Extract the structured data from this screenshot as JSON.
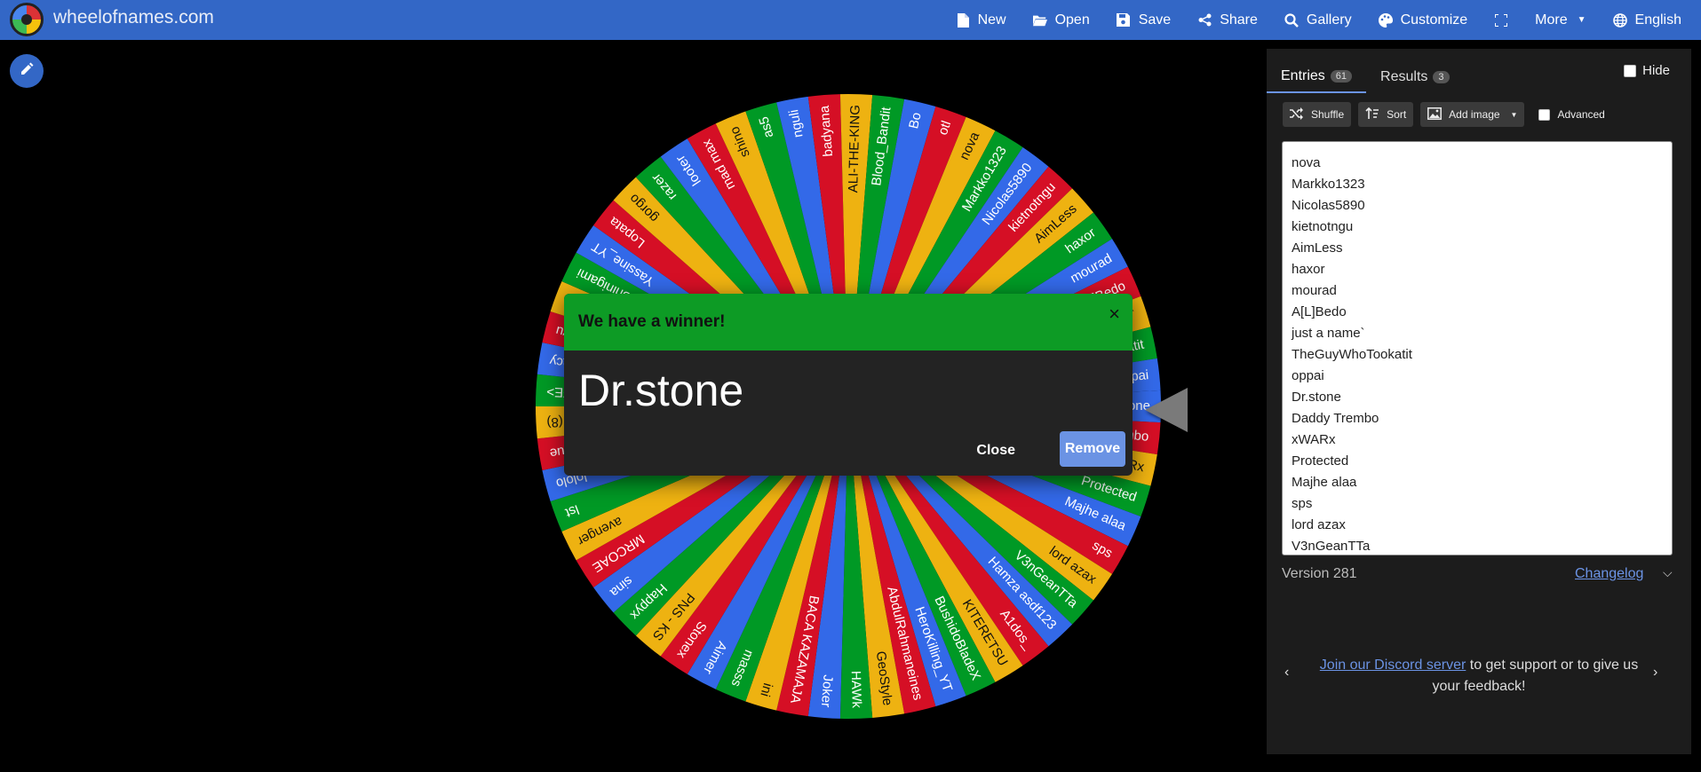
{
  "header": {
    "site_title": "wheelofnames.com",
    "nav": [
      {
        "label": "New",
        "icon": "file-icon"
      },
      {
        "label": "Open",
        "icon": "folder-icon"
      },
      {
        "label": "Save",
        "icon": "save-icon"
      },
      {
        "label": "Share",
        "icon": "share-icon"
      },
      {
        "label": "Gallery",
        "icon": "search-icon"
      },
      {
        "label": "Customize",
        "icon": "palette-icon"
      },
      {
        "label": "",
        "icon": "fullscreen-icon"
      },
      {
        "label": "More",
        "icon": "chevron-down-icon"
      },
      {
        "label": "English",
        "icon": "globe-icon"
      }
    ]
  },
  "wheel": {
    "colors": [
      "#3369e8",
      "#d50f25",
      "#eeb211",
      "#009925"
    ],
    "segment_count": 61,
    "visible_labels": [
      "nova",
      "Markko1323",
      "Nicolas5890",
      "kietnotngu",
      "AimLess",
      "haxor",
      "mourad",
      "A[L]Bedo",
      "just a name`",
      "TheGuyWhoTookatit",
      "oppai",
      "Dr.stone",
      "Daddy Trembo",
      "xWARx",
      "Protected",
      "Majhe alaa",
      "sps",
      "lord azax",
      "V3nGeanTTa",
      "Hamza asdf123",
      "A1dos_",
      "KITERETSU",
      "BushidoBladeX",
      "HeroKilling_YT",
      "AbdulRahmaneines",
      "GeoStyle",
      "HAWk",
      "Joker",
      "BACA KAZAMAJA",
      "ini",
      "masss",
      "Aimer",
      "Stonex",
      "PNS - KS",
      "Happyx",
      "sina",
      "MRCOAE",
      "avenger",
      "lst",
      "lololo",
      "uue",
      "(8)",
      "KNIFE>",
      "Conspiracy",
      "weyu",
      "Emfg",
      "Shinigami",
      "Yassine_YT",
      "Lopata",
      "gorgo",
      "razer",
      "looter",
      "mad max",
      "shino",
      "as5",
      "nguli",
      "badyana",
      "ALI-THE-KING",
      "Blood_Bandit",
      "Bo",
      "otl"
    ]
  },
  "winner_dialog": {
    "title": "We have a winner!",
    "close_x": "×",
    "winner": "Dr.stone",
    "close_label": "Close",
    "remove_label": "Remove"
  },
  "panel": {
    "tabs": [
      {
        "label": "Entries",
        "count": "61"
      },
      {
        "label": "Results",
        "count": "3"
      }
    ],
    "hide_label": "Hide",
    "toolbar": {
      "shuffle": "Shuffle",
      "sort": "Sort",
      "add_image": "Add image",
      "advanced": "Advanced"
    },
    "entries": [
      "nova",
      "Markko1323",
      "Nicolas5890",
      "kietnotngu",
      "AimLess",
      "haxor",
      "mourad",
      "A[L]Bedo",
      "just a name`",
      "TheGuyWhoTookatit",
      "oppai",
      "Dr.stone",
      "Daddy Trembo",
      "xWARx",
      "Protected",
      "Majhe alaa",
      "sps",
      "lord azax",
      "V3nGeanTTa"
    ],
    "version": "Version 281",
    "changelog": "Changelog",
    "discord_link": "Join our Discord server",
    "discord_rest": " to get support or to give us your feedback!"
  }
}
